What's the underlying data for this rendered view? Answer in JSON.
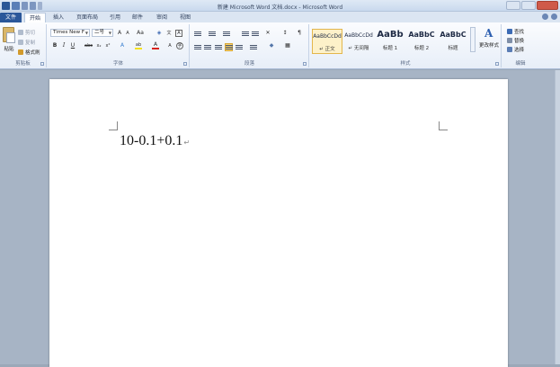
{
  "titlebar": {
    "title": "新建 Microsoft Word 文档.docx - Microsoft Word"
  },
  "quick_access": [
    "word-icon",
    "save-icon",
    "undo-icon",
    "redo-icon",
    "customize-icon"
  ],
  "tabs": [
    {
      "label": "文件"
    },
    {
      "label": "开始"
    },
    {
      "label": "插入"
    },
    {
      "label": "页面布局"
    },
    {
      "label": "引用"
    },
    {
      "label": "邮件"
    },
    {
      "label": "审阅"
    },
    {
      "label": "视图"
    }
  ],
  "ribbon": {
    "clipboard": {
      "paste_label": "粘贴",
      "cut_label": "剪切",
      "copy_label": "复制",
      "format_painter_label": "格式刷",
      "group_label": "剪贴板"
    },
    "font": {
      "font_name": "Times New F",
      "font_size": "二号",
      "group_label": "字体"
    },
    "paragraph": {
      "group_label": "段落"
    },
    "styles": {
      "items": [
        {
          "sample": "AaBbCcDd",
          "name": "↵ 正文"
        },
        {
          "sample": "AaBbCcDd",
          "name": "↵ 无间隔"
        },
        {
          "sample": "AaBb",
          "name": "标题 1"
        },
        {
          "sample": "AaBbC",
          "name": "标题 2"
        },
        {
          "sample": "AaBbC",
          "name": "标题"
        }
      ],
      "change_styles_label": "更改样式",
      "group_label": "样式"
    },
    "editing": {
      "find_label": "查找",
      "replace_label": "替换",
      "select_label": "选择",
      "group_label": "编辑"
    }
  },
  "document": {
    "text": "10-0.1+0.1",
    "paragraph_mark": "↵"
  },
  "colors": {
    "file_tab": "#2b579a",
    "ribbon_bg": "#f3f6fb",
    "app_bg": "#a7b4c5",
    "highlight_yellow": "#f5e11c",
    "font_color_red": "#d8231b"
  }
}
